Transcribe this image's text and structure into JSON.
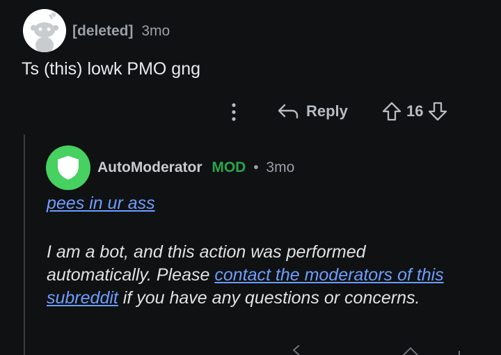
{
  "comment": {
    "author": "[deleted]",
    "time": "3mo",
    "body": "Ts (this) lowk PMO gng",
    "actions": {
      "reply_label": "Reply",
      "score": "16"
    }
  },
  "reply": {
    "author": "AutoModerator",
    "mod_tag": "MOD",
    "separator": "•",
    "time": "3mo",
    "link_text": "pees in ur ass",
    "bot_text_1": "I am a bot, and this action was performed automatically. Please ",
    "contact_link": "contact the moderators of this subreddit",
    "bot_text_2": " if you have any questions or concerns."
  },
  "colors": {
    "background": "#0f1113",
    "link": "#6d9eff",
    "mod_green": "#2aa54b",
    "automod_avatar": "#46d160"
  },
  "icons": [
    "snoo-avatar-icon",
    "more-options-icon",
    "reply-arrow-icon",
    "upvote-icon",
    "downvote-icon",
    "shield-icon"
  ]
}
